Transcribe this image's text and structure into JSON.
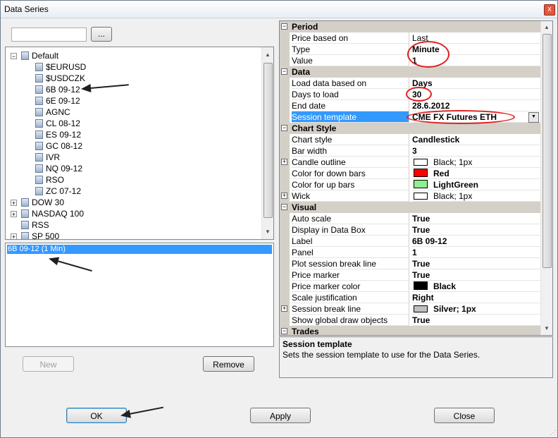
{
  "window": {
    "title": "Data Series",
    "close_glyph": "x"
  },
  "search": {
    "browse_label": "..."
  },
  "tree": {
    "root": "Default",
    "children": [
      "$EURUSD",
      "$USDCZK",
      "6B 09-12",
      "6E 09-12",
      "AGNC",
      "CL 08-12",
      "ES 09-12",
      "GC 08-12",
      "IVR",
      "NQ 09-12",
      "RSO",
      "ZC 07-12"
    ],
    "groups": [
      "DOW 30",
      "NASDAQ 100",
      "RSS",
      "SP 500"
    ]
  },
  "series_list": {
    "items": [
      "6B 09-12 (1 Min)"
    ]
  },
  "buttons": {
    "new": "New",
    "remove": "Remove",
    "ok": "OK",
    "apply": "Apply",
    "close": "Close"
  },
  "properties": {
    "period": {
      "title": "Period",
      "rows": [
        {
          "name": "Price based on",
          "value": "Last"
        },
        {
          "name": "Type",
          "value": "Minute"
        },
        {
          "name": "Value",
          "value": "1"
        }
      ]
    },
    "data": {
      "title": "Data",
      "rows": [
        {
          "name": "Load data based on",
          "value": "Days"
        },
        {
          "name": "Days to load",
          "value": "30"
        },
        {
          "name": "End date",
          "value": "28.6.2012"
        },
        {
          "name": "Session template",
          "value": "CME FX Futures ETH"
        }
      ]
    },
    "chart_style": {
      "title": "Chart Style",
      "rows": [
        {
          "name": "Chart style",
          "value": "Candlestick"
        },
        {
          "name": "Bar width",
          "value": "3"
        },
        {
          "name": "Candle outline",
          "value": "Black; 1px"
        },
        {
          "name": "Color for down bars",
          "value": "Red"
        },
        {
          "name": "Color for up bars",
          "value": "LightGreen"
        },
        {
          "name": "Wick",
          "value": "Black; 1px"
        }
      ]
    },
    "visual": {
      "title": "Visual",
      "rows": [
        {
          "name": "Auto scale",
          "value": "True"
        },
        {
          "name": "Display in Data Box",
          "value": "True"
        },
        {
          "name": "Label",
          "value": "6B 09-12"
        },
        {
          "name": "Panel",
          "value": "1"
        },
        {
          "name": "Plot session break line",
          "value": "True"
        },
        {
          "name": "Price marker",
          "value": "True"
        },
        {
          "name": "Price marker color",
          "value": "Black"
        },
        {
          "name": "Scale justification",
          "value": "Right"
        },
        {
          "name": "Session break line",
          "value": "Silver; 1px"
        },
        {
          "name": "Show global draw objects",
          "value": "True"
        }
      ]
    },
    "trades": {
      "title": "Trades"
    }
  },
  "description": {
    "title": "Session template",
    "text": "Sets the session template to use for the Data Series."
  },
  "colors": {
    "selection": "#3399ff",
    "down_bars": "#ff0000",
    "up_bars": "#90ee90",
    "price_marker": "#000000",
    "annotation": "#e02020"
  },
  "icons": {
    "expand": "+",
    "collapse": "−",
    "dropdown": "▼",
    "scroll_up": "▲",
    "scroll_down": "▼"
  }
}
